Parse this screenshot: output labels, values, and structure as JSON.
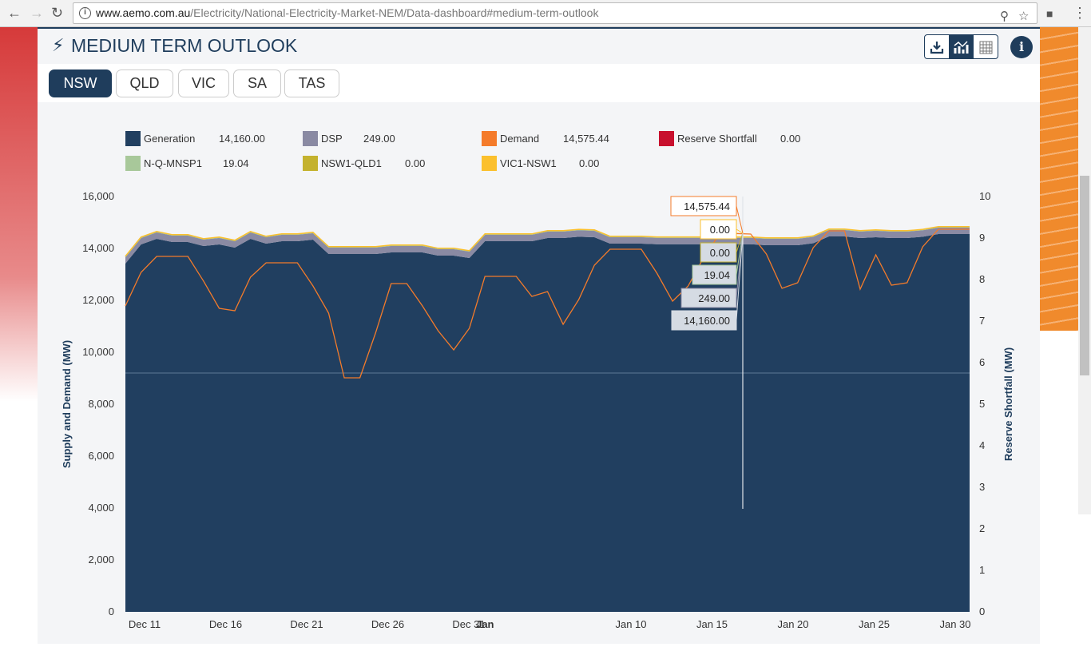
{
  "browser": {
    "url_host": "www.aemo.com.au",
    "url_path": "/Electricity/National-Electricity-Market-NEM/Data-dashboard#medium-term-outlook"
  },
  "header": {
    "title": "MEDIUM TERM OUTLOOK",
    "tools": [
      "download-icon",
      "chart-icon",
      "table-icon"
    ],
    "active_tool": "chart-icon",
    "info": "i"
  },
  "tabs": [
    {
      "label": "NSW",
      "active": true
    },
    {
      "label": "QLD"
    },
    {
      "label": "VIC"
    },
    {
      "label": "SA"
    },
    {
      "label": "TAS"
    }
  ],
  "colors": {
    "generation": "#213f60",
    "dsp": "#8a8aa3",
    "demand": "#f47b2a",
    "reserve": "#c8102e",
    "nqmnsp1": "#a8c89a",
    "nsw1qld1": "#c4b22e",
    "vic1nsw1": "#fbc02d"
  },
  "legend": [
    {
      "name": "Generation",
      "value": "14,160.00",
      "color": "#213f60"
    },
    {
      "name": "DSP",
      "value": "249.00",
      "color": "#8a8aa3"
    },
    {
      "name": "Demand",
      "value": "14,575.44",
      "color": "#f47b2a"
    },
    {
      "name": "Reserve Shortfall",
      "value": "0.00",
      "color": "#c8102e"
    },
    {
      "name": "N-Q-MNSP1",
      "value": "19.04",
      "color": "#a8c89a"
    },
    {
      "name": "NSW1-QLD1",
      "value": "0.00",
      "color": "#c4b22e"
    },
    {
      "name": "VIC1-NSW1",
      "value": "0.00",
      "color": "#fbc02d"
    }
  ],
  "tooltip": {
    "demand": "14,575.44",
    "vic1nsw1": "0.00",
    "nsw1qld1": "0.00",
    "nqmnsp1": "19.04",
    "dsp": "249.00",
    "generation": "14,160.00"
  },
  "chart_data": {
    "type": "area",
    "ylabel": "Supply and Demand (MW)",
    "y2label": "Reserve Shortfall  (MW)",
    "ylim": [
      0,
      16000
    ],
    "yticks": [
      "0",
      "2,000",
      "4,000",
      "6,000",
      "8,000",
      "10,000",
      "12,000",
      "14,000",
      "16,000"
    ],
    "y2lim": [
      0,
      10
    ],
    "y2ticks": [
      "0",
      "1",
      "2",
      "3",
      "4",
      "5",
      "6",
      "7",
      "8",
      "9",
      "10"
    ],
    "xticks": [
      {
        "label": "Dec 11",
        "day": 1
      },
      {
        "label": "Dec 16",
        "day": 6
      },
      {
        "label": "Dec 21",
        "day": 11
      },
      {
        "label": "Dec 26",
        "day": 16
      },
      {
        "label": "Dec 31",
        "day": 21
      },
      {
        "label": "Jan",
        "day": 22,
        "bold": true
      },
      {
        "label": "Jan 10",
        "day": 31
      },
      {
        "label": "Jan 15",
        "day": 36
      },
      {
        "label": "Jan 20",
        "day": 41
      },
      {
        "label": "Jan 25",
        "day": 46
      },
      {
        "label": "Jan 30",
        "day": 51
      }
    ],
    "series": [
      {
        "name": "Generation",
        "type": "stacked-area",
        "values": [
          13415,
          14154,
          14369,
          14246,
          14246,
          14092,
          14154,
          14031,
          14369,
          14185,
          14277,
          14277,
          14338,
          13785,
          13785,
          13785,
          13785,
          13846,
          13846,
          13846,
          13723,
          13723,
          13630,
          14277,
          14277,
          14277,
          14277,
          14400,
          14400,
          14450,
          14431,
          14185,
          14185,
          14185,
          14160,
          14160,
          14160,
          14160,
          14160,
          14160,
          14160,
          14123,
          14123,
          14123,
          14200,
          14462,
          14462,
          14400,
          14431,
          14400,
          14400,
          14450,
          14554,
          14554,
          14554
        ]
      },
      {
        "name": "DSP",
        "type": "stacked-area",
        "constant": 249
      },
      {
        "name": "N-Q-MNSP1",
        "type": "stacked-area",
        "constant": 19.04
      },
      {
        "name": "NSW1-QLD1",
        "type": "stacked-area",
        "constant": 0
      },
      {
        "name": "VIC1-NSW1",
        "type": "stacked-area",
        "constant": 0
      },
      {
        "name": "Demand",
        "type": "line",
        "values": [
          11785,
          13077,
          13692,
          13692,
          13692,
          12740,
          11692,
          11600,
          12892,
          13446,
          13446,
          13446,
          12554,
          11508,
          9015,
          9015,
          10738,
          12646,
          12646,
          11785,
          10830,
          10092,
          10923,
          12923,
          12923,
          12923,
          12150,
          12338,
          11077,
          12030,
          13354,
          13969,
          13969,
          13969,
          13046,
          11969,
          12554,
          13660,
          14554,
          14575,
          14554,
          13785,
          12462,
          12677,
          14031,
          14677,
          14677,
          12430,
          13754,
          12585,
          12677,
          14062,
          14738,
          14738,
          14738
        ]
      },
      {
        "name": "Reserve Shortfall",
        "type": "line",
        "axis": "right",
        "constant": 0
      }
    ],
    "hover_index": 39,
    "grid": false
  }
}
